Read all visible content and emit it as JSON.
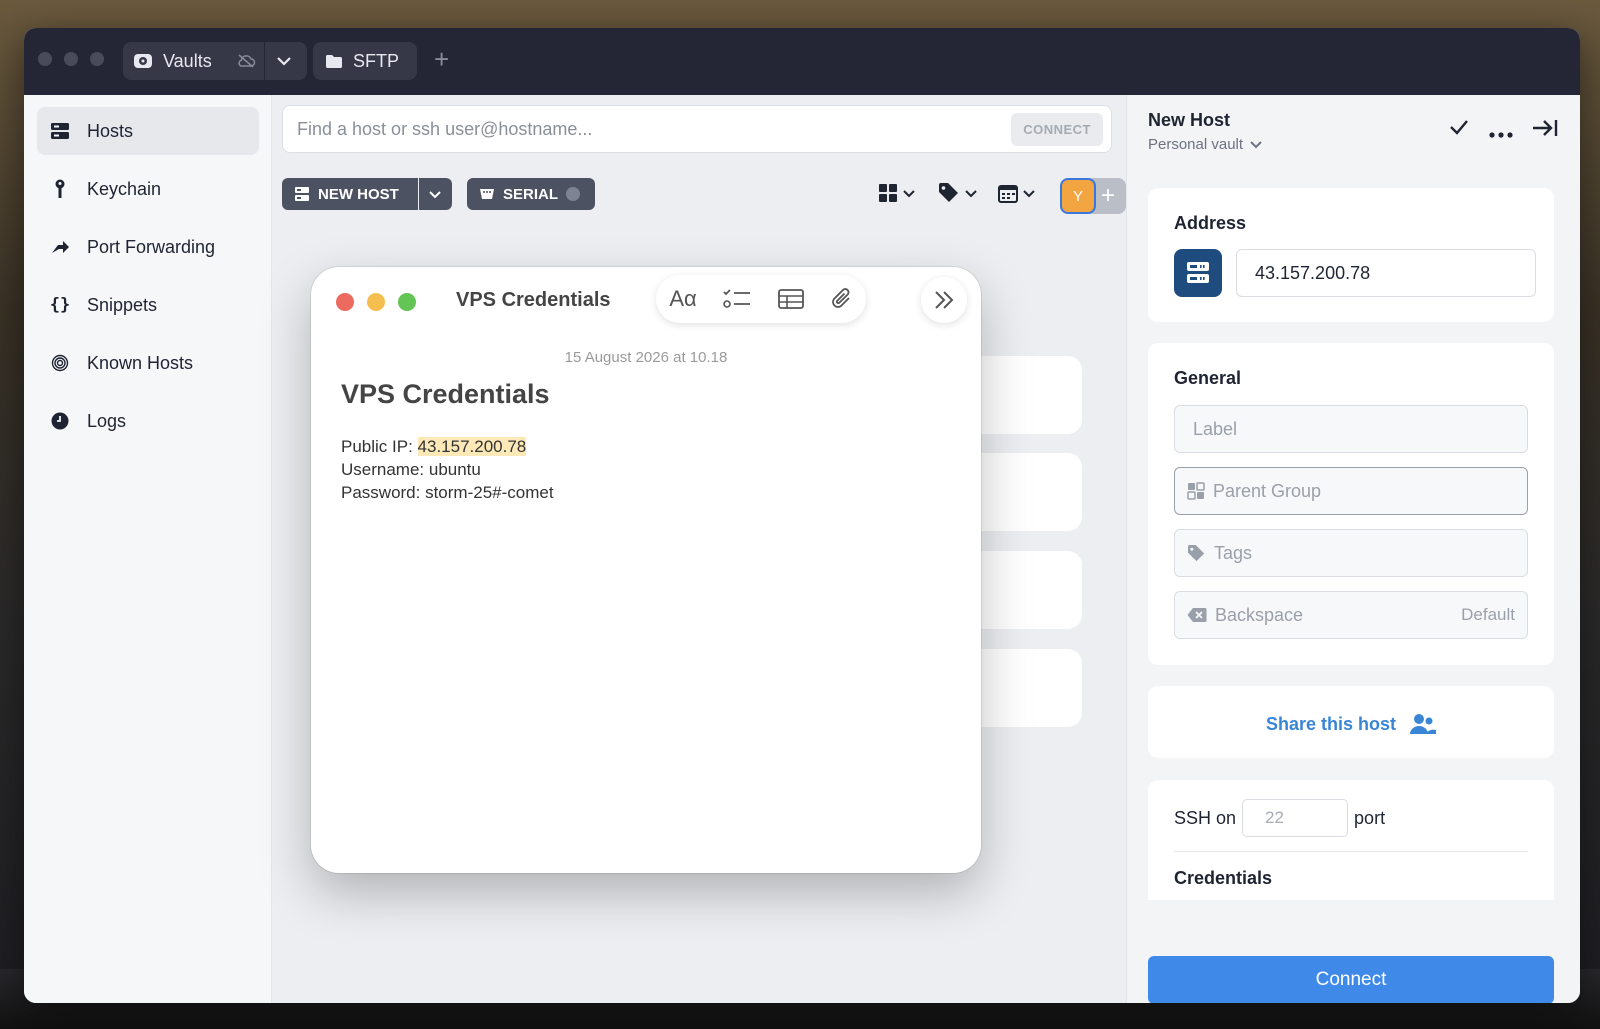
{
  "titlebar": {
    "tabs": [
      {
        "label": "Vaults",
        "icon": "vault-icon"
      },
      {
        "label": "SFTP",
        "icon": "folder-icon"
      }
    ]
  },
  "sidebar": {
    "items": [
      {
        "label": "Hosts",
        "icon": "hosts-icon",
        "active": true
      },
      {
        "label": "Keychain",
        "icon": "key-icon"
      },
      {
        "label": "Port Forwarding",
        "icon": "port-forward-icon"
      },
      {
        "label": "Snippets",
        "icon": "braces-icon"
      },
      {
        "label": "Known Hosts",
        "icon": "fingerprint-icon"
      },
      {
        "label": "Logs",
        "icon": "clock-icon"
      }
    ]
  },
  "main": {
    "search_placeholder": "Find a host or ssh user@hostname...",
    "connect_label": "CONNECT",
    "new_host_label": "NEW HOST",
    "serial_label": "SERIAL",
    "avatar_initial": "Y"
  },
  "note": {
    "window_title": "VPS Credentials",
    "date": "15 August 2026 at 10.18",
    "heading": "VPS Credentials",
    "format_label": "Aα",
    "lines": {
      "ip_prefix": "Public IP: ",
      "ip_value": "43.157.200.78",
      "username": "Username: ubuntu",
      "password": "Password: storm-25#-comet"
    }
  },
  "panel": {
    "title": "New Host",
    "vault": "Personal vault",
    "address": {
      "heading": "Address",
      "value": "43.157.200.78"
    },
    "general": {
      "heading": "General",
      "label_placeholder": "Label",
      "parent_group_placeholder": "Parent Group",
      "tags_placeholder": "Tags",
      "backspace_label": "Backspace",
      "backspace_default": "Default"
    },
    "share_label": "Share this host",
    "ssh": {
      "prefix": "SSH on",
      "port_placeholder": "22",
      "suffix": "port",
      "credentials_heading": "Credentials"
    },
    "connect_label": "Connect"
  },
  "colors": {
    "accent": "#3f8ae8",
    "titlebar": "#242535",
    "avatar": "#f2a541",
    "address_icon": "#1e4c7f",
    "highlight": "#fde9b7"
  }
}
